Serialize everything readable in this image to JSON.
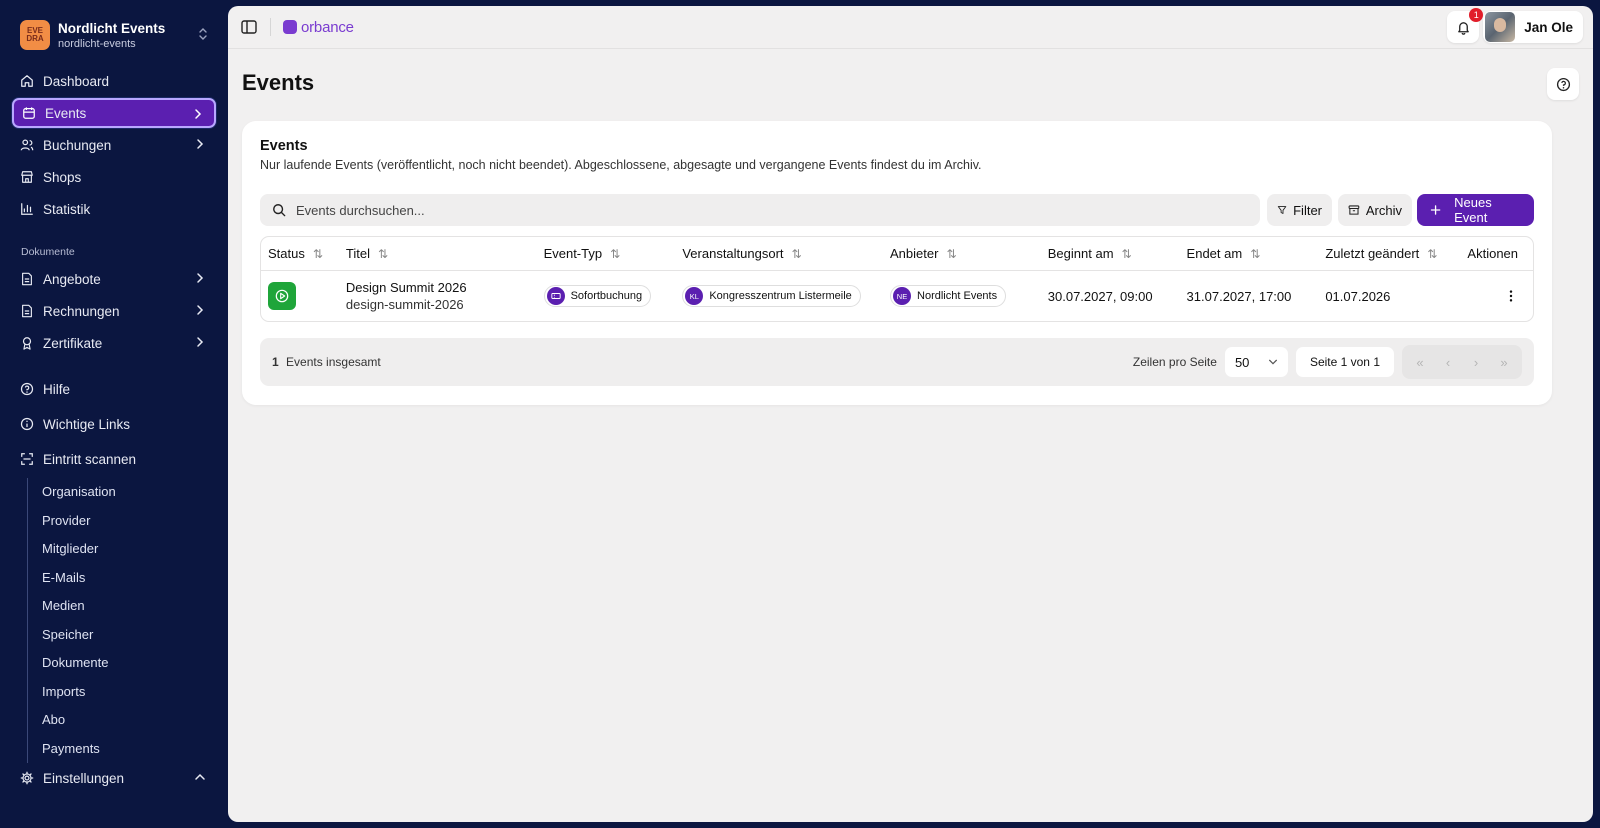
{
  "org": {
    "name": "Nordlicht Events",
    "slug": "nordlicht-events",
    "logo_text": "EVE DRA"
  },
  "sidebar": {
    "items": [
      {
        "label": "Dashboard",
        "icon": "home-icon"
      },
      {
        "label": "Events",
        "icon": "calendar-icon",
        "active": true
      },
      {
        "label": "Buchungen",
        "icon": "users-icon"
      },
      {
        "label": "Shops",
        "icon": "store-icon"
      },
      {
        "label": "Statistik",
        "icon": "bar-chart-icon"
      }
    ],
    "docs_section_label": "Dokumente",
    "docs_items": [
      {
        "label": "Angebote",
        "icon": "document-icon"
      },
      {
        "label": "Rechnungen",
        "icon": "document-icon"
      },
      {
        "label": "Zertifikate",
        "icon": "award-icon"
      }
    ],
    "misc_items": [
      {
        "label": "Hilfe",
        "icon": "help-circle-icon"
      },
      {
        "label": "Wichtige Links",
        "icon": "info-icon"
      },
      {
        "label": "Eintritt scannen",
        "icon": "scan-icon"
      }
    ],
    "settings_sub": [
      "Organisation",
      "Provider",
      "Mitglieder",
      "E-Mails",
      "Medien",
      "Speicher",
      "Dokumente",
      "Imports",
      "Abo",
      "Payments"
    ],
    "settings_label": "Einstellungen"
  },
  "topbar": {
    "brand": "orbance",
    "notification_count": "1",
    "user_name": "Jan Ole"
  },
  "page": {
    "title": "Events"
  },
  "card": {
    "title": "Events",
    "description": "Nur laufende Events (veröffentlicht, noch nicht beendet). Abgeschlossene, abgesagte und vergangene Events findest du im Archiv.",
    "search_placeholder": "Events durchsuchen...",
    "filter_label": "Filter",
    "archive_label": "Archiv",
    "new_event_label": "Neues Event"
  },
  "table": {
    "columns": [
      "Status",
      "Titel",
      "Event-Typ",
      "Veranstaltungsort",
      "Anbieter",
      "Beginnt am",
      "Endet am",
      "Zuletzt geändert",
      "Aktionen"
    ],
    "rows": [
      {
        "status": "running",
        "title": "Design Summit 2026",
        "slug": "design-summit-2026",
        "type": "Sofortbuchung",
        "venue_initials": "KL",
        "venue": "Kongresszentrum Listermeile",
        "provider_initials": "NE",
        "provider": "Nordlicht Events",
        "start": "30.07.2027, 09:00",
        "end": "31.07.2027, 17:00",
        "modified": "01.07.2026"
      }
    ]
  },
  "footer": {
    "count": "1",
    "count_label": "Events insgesamt",
    "rows_per_page_label": "Zeilen pro Seite",
    "rows_per_page": "50",
    "page_info": "Seite 1 von 1"
  },
  "colors": {
    "sidebar_bg": "#0b1640",
    "accent": "#5b1fb0",
    "status_running": "#1fa53a",
    "badge": "#e11d2a"
  }
}
